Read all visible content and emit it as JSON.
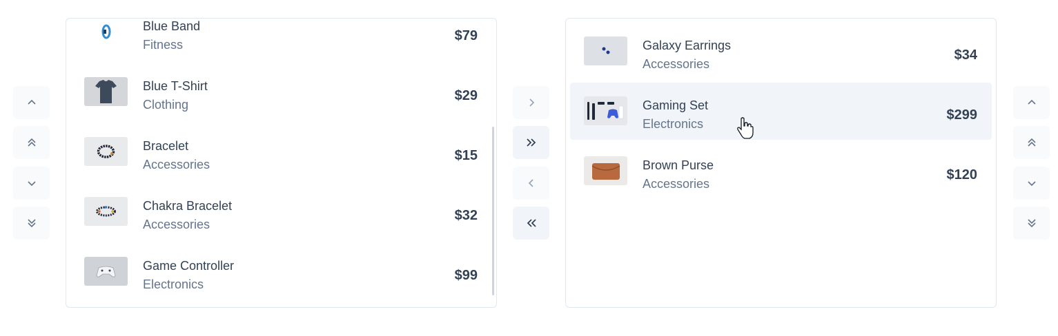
{
  "source_list": {
    "items": [
      {
        "name": "Blue Band",
        "category": "Fitness",
        "price": "$79",
        "image_icon": "blue-band-image"
      },
      {
        "name": "Blue T-Shirt",
        "category": "Clothing",
        "price": "$29",
        "image_icon": "tshirt-image"
      },
      {
        "name": "Bracelet",
        "category": "Accessories",
        "price": "$15",
        "image_icon": "bracelet-image"
      },
      {
        "name": "Chakra Bracelet",
        "category": "Accessories",
        "price": "$32",
        "image_icon": "chakra-bracelet-image"
      },
      {
        "name": "Game Controller",
        "category": "Electronics",
        "price": "$99",
        "image_icon": "game-controller-image"
      }
    ]
  },
  "target_list": {
    "items": [
      {
        "name": "Galaxy Earrings",
        "category": "Accessories",
        "price": "$34",
        "image_icon": "earrings-image"
      },
      {
        "name": "Gaming Set",
        "category": "Electronics",
        "price": "$299",
        "image_icon": "gaming-set-image",
        "selected": true
      },
      {
        "name": "Brown Purse",
        "category": "Accessories",
        "price": "$120",
        "image_icon": "purse-image"
      }
    ]
  },
  "source_controls": [
    "move-up",
    "move-top",
    "move-down",
    "move-bottom"
  ],
  "transfer_controls": [
    "move-to-target",
    "move-all-to-target",
    "move-to-source",
    "move-all-to-source"
  ],
  "target_controls": [
    "move-up",
    "move-top",
    "move-down",
    "move-bottom"
  ],
  "colors": {
    "selected_row": "#f1f5f9",
    "border": "#e2e8f0",
    "muted_text": "#64748b",
    "text": "#334155"
  }
}
